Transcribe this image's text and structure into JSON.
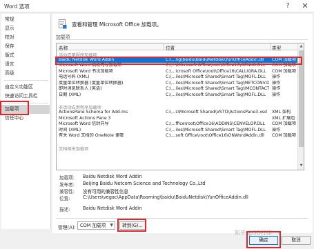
{
  "window": {
    "title": "Word 选项",
    "help": "?",
    "close": "✕"
  },
  "sidebar": {
    "items": [
      {
        "label": "常规"
      },
      {
        "label": "显示"
      },
      {
        "label": "校对"
      },
      {
        "label": "保存"
      },
      {
        "label": "版式"
      },
      {
        "label": "语言"
      },
      {
        "label": "高级"
      },
      {
        "label": "自定义功能区"
      },
      {
        "label": "快速访问工具栏"
      },
      {
        "label": "加载项"
      },
      {
        "label": "信任中心"
      }
    ],
    "active_index": 9
  },
  "header": {
    "text": "查看和管理 Microsoft Office 加载项。"
  },
  "section": {
    "label": "加载项"
  },
  "grid": {
    "columns": [
      "名称",
      "位置",
      "类型"
    ],
    "rows": [
      {
        "kind": "group",
        "name": "活动应用程序加载项"
      },
      {
        "kind": "row",
        "name": "Baidu Netdisk Word Addin",
        "location": "C:\\...ng\\baidu\\BaiduNetdisk\\YunOfficeAddin.dll",
        "type": "COM 加载项",
        "selected": true
      },
      {
        "kind": "row",
        "name": "Microsoft Word 稿纸向导加载项",
        "location": "C:\\...\\Microsoft Office\\root\\Office16\\GENKO.DLL",
        "type": "COM 加载项"
      },
      {
        "kind": "row",
        "name": "Microsoft Word 书法加载项",
        "location": "C:\\...icrosoft Office\\root\\Office16\\CALLIGRA.DLL",
        "type": "COM 加载项"
      },
      {
        "kind": "row",
        "name": "电话号码 (XML)",
        "location": "C:\\...iles\\Microsoft Shared\\Smart Tag\\MOFL.DLL",
        "type": "操作"
      },
      {
        "kind": "row",
        "name": "度量单位转换器 (度量单位转换器)",
        "location": "C:\\...iles\\Microsoft Shared\\Smart Tag\\METCONV.DLL",
        "type": "操作"
      },
      {
        "kind": "row",
        "name": "即时消息联系人 (英语)",
        "location": "C:\\...iles\\Microsoft Shared\\Smart Tag\\IMCONTACT.DLL",
        "type": "操作"
      },
      {
        "kind": "row",
        "name": "日期 (XML)",
        "location": "C:\\...iles\\Microsoft Shared\\Smart Tag\\MOFL.DLL",
        "type": "操作"
      },
      {
        "kind": "blank"
      },
      {
        "kind": "group",
        "name": "非活动应用程序加载项"
      },
      {
        "kind": "row",
        "name": "ActionsPane Schema for Add-Ins",
        "location": "C:\\...s\\Microsoft Shared\\VSTO\\ActionsPane3.xsd",
        "type": "XML 架构"
      },
      {
        "kind": "row",
        "name": "Microsoft Actions Pane 3",
        "location": "",
        "type": "XML 扩展包"
      },
      {
        "kind": "row",
        "name": "Microsoft Word 信封向导",
        "location": "C:\\...ffice\\root\\Office16\\ADDINS\\CENVELOP.DLL",
        "type": "COM 加载项"
      },
      {
        "kind": "row",
        "name": "时间 (XML)",
        "location": "C:\\...iles\\Microsoft Shared\\Smart Tag\\MOFL.DLL",
        "type": "操作"
      },
      {
        "kind": "row",
        "name": "有关 Word 文档的 OneNote 便笺",
        "location": "C:\\...soft Office\\root\\Office16\\ONWordAddin.dll",
        "type": "COM 加载项"
      },
      {
        "kind": "blank"
      },
      {
        "kind": "group",
        "name": "文档相关加载项"
      }
    ]
  },
  "details": [
    {
      "label": "加载项:",
      "value": "Baidu Netdisk Word Addin"
    },
    {
      "label": "发布者:",
      "value": "Beijing Baidu Netcom Science and Technology Co.,Ltd"
    },
    {
      "label": "兼容性:",
      "value": "没有可用的兼容性信息"
    },
    {
      "label": "位置:",
      "value": "C:\\Users\\vegac\\AppData\\Roaming\\baidu\\BaiduNetdisk\\YunOfficeAddin.dll"
    },
    {
      "label": "描述:",
      "value": "Baidu Netdisk Word Addin"
    }
  ],
  "manage": {
    "label": "管理(A):",
    "value": "COM 加载项",
    "goto_label": "转到(G)..."
  },
  "buttons": {
    "ok": "确定",
    "cancel": "取消"
  },
  "watermark": "知乎 @3D打印",
  "colors": {
    "selection": "#0a74da",
    "highlight_box": "#e0262b"
  }
}
